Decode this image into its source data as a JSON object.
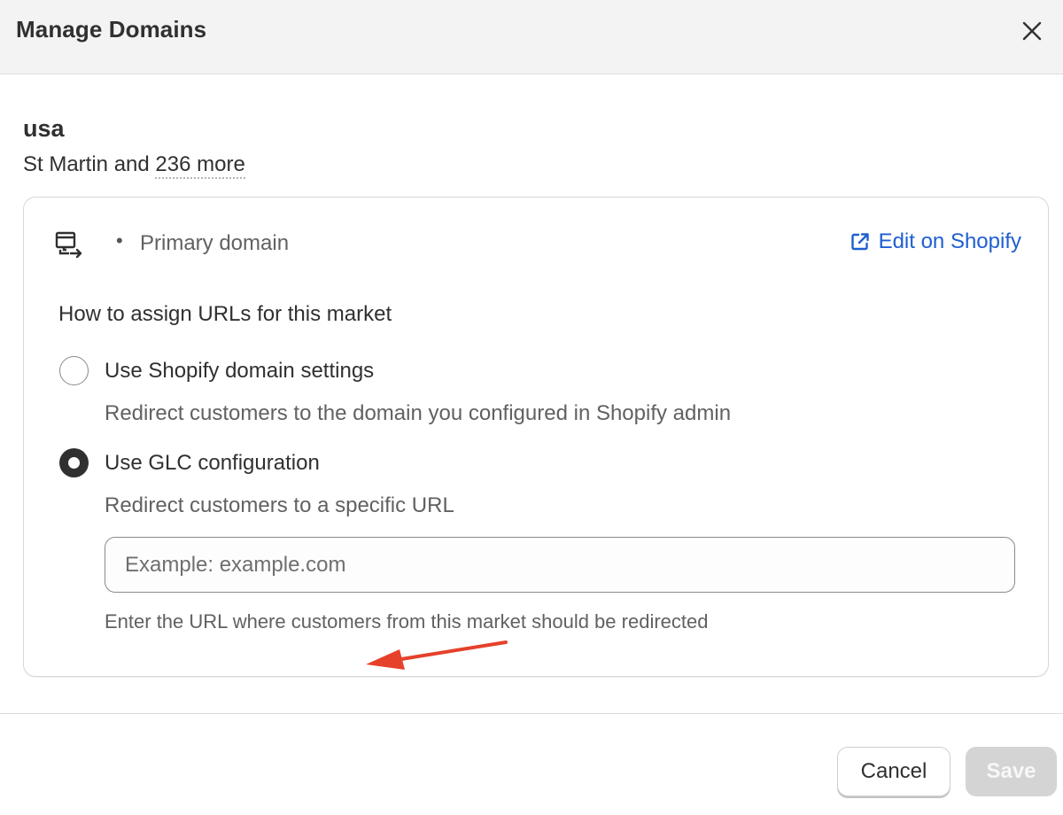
{
  "modal": {
    "title": "Manage Domains",
    "close_icon": "close-icon"
  },
  "market": {
    "name": "usa",
    "regions_prefix": "St Martin and ",
    "regions_more": "236 more"
  },
  "card": {
    "domain_icon": "domain-redirect-icon",
    "bullet": "•",
    "primary_domain_label": "Primary domain",
    "edit_link_label": "Edit on Shopify",
    "edit_link_icon": "external-link-icon",
    "edit_link_color": "#1f5fd1",
    "assign_heading": "How to assign URLs for this market",
    "options": [
      {
        "label": "Use Shopify domain settings",
        "description": "Redirect customers to the domain you configured in Shopify admin",
        "selected": false
      },
      {
        "label": "Use GLC configuration",
        "description": "Redirect customers to a specific URL",
        "selected": true
      }
    ],
    "url_input": {
      "value": "",
      "placeholder": "Example: example.com"
    },
    "help_text": "Enter the URL where customers from this market should be redirected"
  },
  "annotation": {
    "arrow_color": "#e5412b",
    "arrow_icon": "red-arrow-annotation"
  },
  "footer": {
    "cancel_label": "Cancel",
    "save_label": "Save",
    "save_disabled": true
  }
}
